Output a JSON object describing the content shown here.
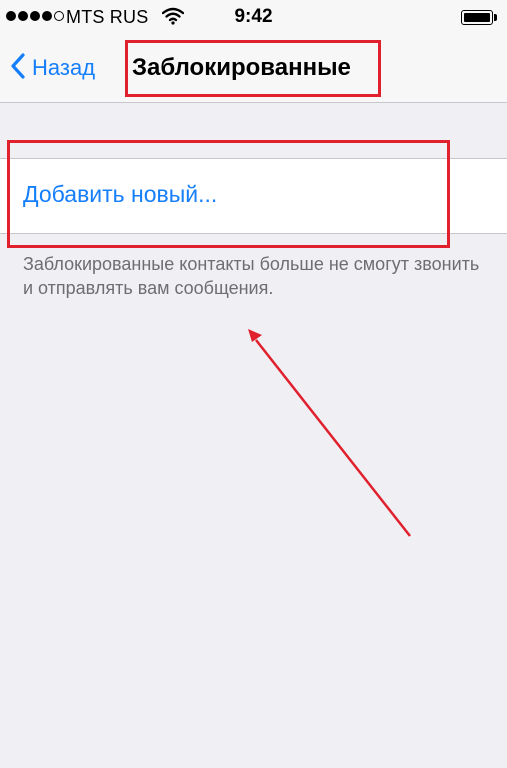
{
  "status_bar": {
    "carrier": "MTS RUS",
    "time": "9:42",
    "signal_bars_filled": 4,
    "signal_bars_total": 5,
    "battery_level": 1.0
  },
  "nav": {
    "back_label": "Назад",
    "title": "Заблокированные"
  },
  "list": {
    "add_new_label": "Добавить новый..."
  },
  "footer": {
    "note": "Заблокированные контакты больше не смогут звонить и отправлять вам сообщения."
  },
  "colors": {
    "accent": "#147efb",
    "annotation": "#e0202d",
    "background": "#efeff4",
    "secondary_text": "#6d6d72"
  },
  "icons": {
    "back": "chevron-left-icon",
    "wifi": "wifi-icon",
    "battery": "battery-icon"
  }
}
